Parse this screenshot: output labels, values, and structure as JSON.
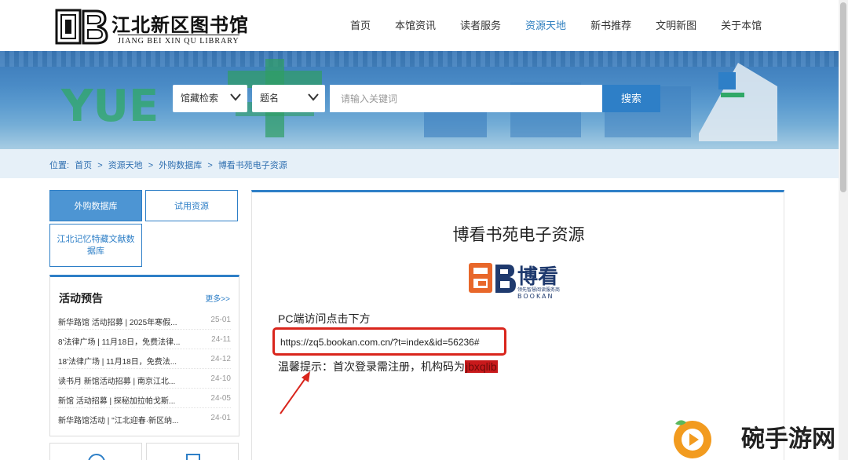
{
  "header": {
    "logo_cn": "江北新区图书馆",
    "logo_en": "JIANG BEI XIN QU LIBRARY",
    "nav": [
      {
        "label": "首页",
        "active": false
      },
      {
        "label": "本馆资讯",
        "active": false
      },
      {
        "label": "读者服务",
        "active": false
      },
      {
        "label": "资源天地",
        "active": true
      },
      {
        "label": "新书推荐",
        "active": false
      },
      {
        "label": "文明新图",
        "active": false
      },
      {
        "label": "关于本馆",
        "active": false
      }
    ]
  },
  "search": {
    "scope_select": "馆藏检索",
    "field_select": "题名",
    "placeholder": "请输入关键词",
    "button": "搜索"
  },
  "breadcrumb": {
    "prefix": "位置:",
    "items": [
      "首页",
      "资源天地",
      "外购数据库",
      "博看书苑电子资源"
    ],
    "separator": ">"
  },
  "sidebar": {
    "buttons": [
      {
        "label": "外购数据库",
        "active": true
      },
      {
        "label": "试用资源",
        "active": false
      },
      {
        "label": "江北记忆特藏文献数据库",
        "active": false
      }
    ],
    "activity": {
      "title": "活动预告",
      "more": "更多>>",
      "items": [
        {
          "text": "新华路馆 活动招募 | 2025年寒假...",
          "date": "25-01"
        },
        {
          "text": "8'法律广场 | 11月18日，免费法律...",
          "date": "24-11"
        },
        {
          "text": "18'法律广场 | 11月18日，免费法...",
          "date": "24-12"
        },
        {
          "text": "读书月 新馆活动招募 | 南京江北...",
          "date": "24-10"
        },
        {
          "text": "新馆 活动招募 | 探秘加拉帕戈斯...",
          "date": "24-05"
        },
        {
          "text": "新华路馆活动 | \"江北迎春·新区纳...",
          "date": "24-01"
        }
      ]
    }
  },
  "main": {
    "title": "博看书苑电子资源",
    "logo_cn": "博看",
    "logo_tagline": "领先智慧阅读服务商",
    "logo_en": "BOOKAN",
    "pc_text": "PC端访问点击下方",
    "url": "https://zq5.bookan.com.cn/?t=index&id=56236#",
    "tip_prefix": "温馨提示：首次登录需注册，机构码为",
    "tip_code": "jbxqlib"
  },
  "banner": {
    "deco_text": "YUE"
  },
  "watermark": {
    "text": "碗手游网"
  },
  "colors": {
    "accent": "#2e7fc7",
    "highlight_red": "#d9251c",
    "banner": "#4a8bc6"
  }
}
